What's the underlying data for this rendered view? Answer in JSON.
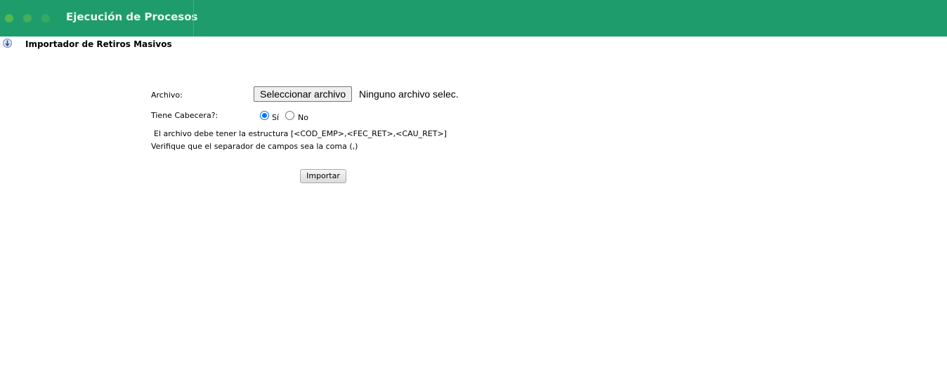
{
  "header": {
    "title": "Ejecución de Procesos",
    "dot_colors": [
      "#52b84e",
      "#43ad5c",
      "#37a766"
    ],
    "background_color": "#1f9c6c"
  },
  "section": {
    "icon": "down-arrow-info-icon",
    "title": "Importador de Retiros Masivos"
  },
  "form": {
    "archivo_label": "Archivo:",
    "file_button_label": "Seleccionar archivo",
    "file_status": "Ninguno archivo selec.",
    "cabecera_label": "Tiene Cabecera?:",
    "radio_si_label": "Sí",
    "radio_no_label": "No",
    "selected_option": "Sí",
    "structure_note": "El archivo debe tener la estructura [<COD_EMP>,<FEC_RET>,<CAU_RET>]",
    "separator_note": "Verifique que el separador de campos sea la coma (,)",
    "import_button_label": "Importar"
  }
}
